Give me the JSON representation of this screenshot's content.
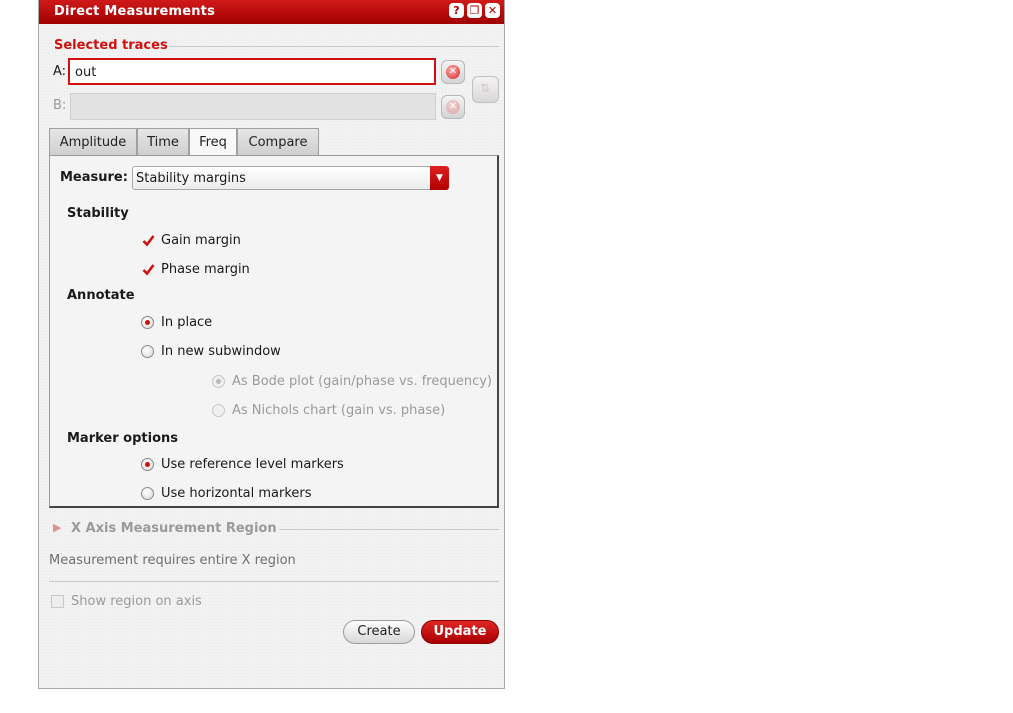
{
  "window": {
    "title": "Direct Measurements",
    "buttons": [
      "?",
      "❐",
      "✕"
    ]
  },
  "selected_traces": {
    "heading": "Selected traces",
    "a_label": "A:",
    "a_value": "out",
    "b_label": "B:",
    "b_value": ""
  },
  "tabs": [
    {
      "label": "Amplitude",
      "active": false
    },
    {
      "label": "Time",
      "active": false
    },
    {
      "label": "Freq",
      "active": true
    },
    {
      "label": "Compare",
      "active": false
    }
  ],
  "freq": {
    "measure_label": "Measure:",
    "measure_value": "Stability margins",
    "stability_heading": "Stability",
    "gain_margin": {
      "label": "Gain margin",
      "checked": true
    },
    "phase_margin": {
      "label": "Phase margin",
      "checked": true
    },
    "annotate_heading": "Annotate",
    "in_place": {
      "label": "In place",
      "selected": true
    },
    "in_new_subwindow": {
      "label": "In new subwindow",
      "selected": false
    },
    "bode_plot": {
      "label": "As Bode plot (gain/phase vs. frequency)",
      "selected": true,
      "disabled": true
    },
    "nichols_chart": {
      "label": "As Nichols chart (gain vs. phase)",
      "selected": false,
      "disabled": true
    },
    "marker_heading": "Marker options",
    "reference_markers": {
      "label": "Use reference level markers",
      "selected": true
    },
    "horizontal_markers": {
      "label": "Use horizontal markers",
      "selected": false
    }
  },
  "x_axis": {
    "heading": "X Axis Measurement Region",
    "note": "Measurement requires entire X region",
    "show_region": {
      "label": "Show region on axis",
      "checked": false
    }
  },
  "actions": {
    "create_label": "Create",
    "update_label": "Update"
  },
  "colors": {
    "accent": "#d01010",
    "title_bar": "#b00000"
  }
}
